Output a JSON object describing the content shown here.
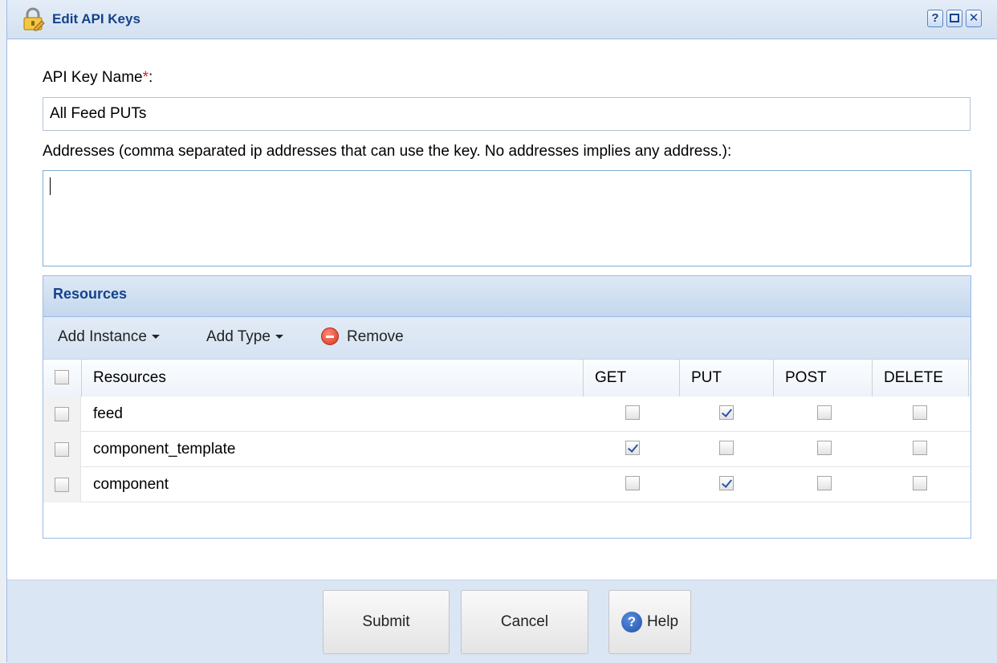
{
  "window": {
    "title": "Edit API Keys",
    "tools": {
      "help": "?",
      "maximize": "",
      "close": "✕"
    }
  },
  "form": {
    "name_label": "API Key Name",
    "required_mark": "*",
    "name_label_suffix": ":",
    "name_value": "All Feed PUTs",
    "addresses_label": "Addresses (comma separated ip addresses that can use the key. No addresses implies any address.):",
    "addresses_value": ""
  },
  "resources": {
    "panel_title": "Resources",
    "toolbar": {
      "add_instance": "Add Instance",
      "add_type": "Add Type",
      "remove": "Remove"
    },
    "columns": [
      "Resources",
      "GET",
      "PUT",
      "POST",
      "DELETE"
    ],
    "rows": [
      {
        "name": "feed",
        "get": false,
        "put": true,
        "post": false,
        "delete": false
      },
      {
        "name": "component_template",
        "get": true,
        "put": false,
        "post": false,
        "delete": false
      },
      {
        "name": "component",
        "get": false,
        "put": true,
        "post": false,
        "delete": false
      }
    ]
  },
  "footer": {
    "submit": "Submit",
    "cancel": "Cancel",
    "help": "Help"
  },
  "colors": {
    "title_text": "#15428b",
    "panel_border": "#99bbe8",
    "footer_bg": "#dbe6f4",
    "required_mark": "#e02020"
  },
  "icons": {
    "title": "lock-edit-icon",
    "remove": "remove-circle-icon",
    "help": "help-circle-icon"
  }
}
